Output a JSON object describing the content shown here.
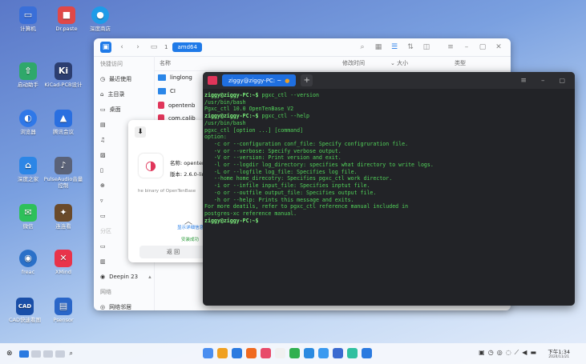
{
  "desktop_icons": [
    {
      "label": "计算机",
      "color": "#3a6fd8",
      "glyph": "▭"
    },
    {
      "label": "Dr.paste",
      "color": "#e04848",
      "glyph": "■"
    },
    {
      "label": "深度商店",
      "color": "#1e9be8",
      "glyph": "●"
    },
    {
      "label": "启动助手",
      "color": "#2fa86a",
      "glyph": "⇧"
    },
    {
      "label": "KiCad-PCB设计",
      "color": "#2c3e70",
      "glyph": "Ki"
    },
    {
      "label": "浏览器",
      "color": "#2f78e8",
      "glyph": "◐"
    },
    {
      "label": "腾讯会议",
      "color": "#2a6fe0",
      "glyph": "▲"
    },
    {
      "label": "深度之家",
      "color": "#2c86e6",
      "glyph": "⌂"
    },
    {
      "label": "PulseAudio音量控制",
      "color": "#5a6278",
      "glyph": "♪"
    },
    {
      "label": "微信",
      "color": "#2ec05a",
      "glyph": "✉"
    },
    {
      "label": "连连看",
      "color": "#6a4a2a",
      "glyph": "✦"
    },
    {
      "label": "freac",
      "color": "#2a70c8",
      "glyph": "◉"
    },
    {
      "label": "XMind",
      "color": "#e8334a",
      "glyph": "✕"
    },
    {
      "label": "CAD快速看图",
      "color": "#1a4fa8",
      "glyph": "CAD"
    },
    {
      "label": "Psensor",
      "color": "#2a66c8",
      "glyph": "▤"
    }
  ],
  "file_manager": {
    "path_crumb": "amd64",
    "crumb_num": "1",
    "sidebar": [
      "快捷访问",
      "最近使用",
      "主目录",
      "桌面",
      "",
      "",
      "",
      "",
      "",
      "",
      "",
      "",
      "",
      "Deepin 23",
      "网络",
      "网络邻居"
    ],
    "col_name": "名称",
    "col_mtime": "修改时间",
    "col_size": "大小",
    "col_type": "类型",
    "rows": [
      {
        "name": "linglong",
        "kind": "folder"
      },
      {
        "name": "CI",
        "kind": "folder"
      },
      {
        "name": "opentenb",
        "kind": "pkg"
      },
      {
        "name": "com.calib",
        "kind": "pkg"
      }
    ]
  },
  "dialog": {
    "name_label": "名称: opentenb",
    "version_label": "版本: 2.6.0-liny",
    "desc": "he binary of OpenTenBase",
    "show_details": "显示详细信息",
    "installed": "安装成功",
    "back_button": "返 回"
  },
  "terminal": {
    "tab_title": "ziggy@ziggy-PC: ~",
    "prompt": "ziggy@ziggy-PC:~$",
    "lines": [
      {
        "p": "ziggy@ziggy-PC:~$",
        "t": " pgxc_ctl --version"
      },
      {
        "p": "",
        "t": "/usr/bin/bash"
      },
      {
        "p": "",
        "t": "Pgxc_ctl 10.0 OpenTenBase V2"
      },
      {
        "p": "ziggy@ziggy-PC:~$",
        "t": " pgxc_ctl --help"
      },
      {
        "p": "",
        "t": "/usr/bin/bash"
      },
      {
        "p": "",
        "t": "pgxc_ctl [option ...] [command]"
      },
      {
        "p": "",
        "t": "option:"
      },
      {
        "p": "",
        "t": "   -c or --configuration conf_file: Specify configruration file."
      },
      {
        "p": "",
        "t": "   -v or --verbose: Specify verbose output."
      },
      {
        "p": "",
        "t": "   -V or --version: Print version and exit."
      },
      {
        "p": "",
        "t": "   -l or --logdir log_directory: specifies what directory to write logs."
      },
      {
        "p": "",
        "t": "   -L or --logfile log_file: Specifies log file."
      },
      {
        "p": "",
        "t": "   --home home_direcotry: Specifies pgxc_ctl work director."
      },
      {
        "p": "",
        "t": "   -i or --infile input_file: Specifies inptut file."
      },
      {
        "p": "",
        "t": "   -o or --outfile output_file: Specifies output file."
      },
      {
        "p": "",
        "t": "   -h or --help: Prints this message and exits."
      },
      {
        "p": "",
        "t": "For more deatils, refer to pgxc_ctl reference manual included in"
      },
      {
        "p": "",
        "t": "postgres-xc reference manual."
      },
      {
        "p": "ziggy@ziggy-PC:~$",
        "t": ""
      }
    ]
  },
  "taskbar": {
    "clock_time": "下午1:34",
    "clock_date": "2024/11/21",
    "app_colors": [
      "#4a8ef0",
      "#f0a020",
      "#2a7ae0",
      "#f06a20",
      "#e84a6a",
      "#f0f0f0",
      "#30b050",
      "#2a8ae0",
      "#3a9af0",
      "#3a6ad0",
      "#30c0a0",
      "#2a7ae0"
    ]
  }
}
